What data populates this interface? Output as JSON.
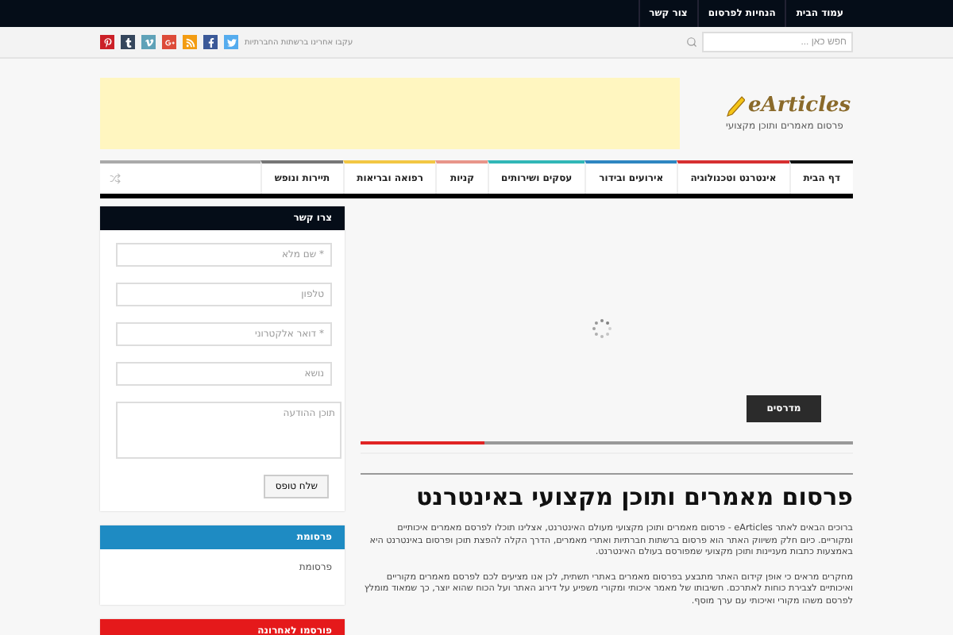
{
  "top_menu": [
    "עמוד הבית",
    "הנחיות לפרסום",
    "צור קשר"
  ],
  "search": {
    "placeholder": "חפש כאן ..."
  },
  "social_text": "עקבו אחרינו ברשתות החברתיות",
  "social": [
    {
      "kind": "twitter",
      "color": "#55acee"
    },
    {
      "kind": "facebook",
      "color": "#3b5998"
    },
    {
      "kind": "rss",
      "color": "#f39c12"
    },
    {
      "kind": "googleplus",
      "color": "#dd4b39"
    },
    {
      "kind": "vimeo",
      "color": "#5fa2b8"
    },
    {
      "kind": "tumblr",
      "color": "#35465c"
    },
    {
      "kind": "pinterest",
      "color": "#cb2027"
    }
  ],
  "logo": {
    "name": "eArticles",
    "tagline": "פרסום מאמרים ותוכן מקצועי"
  },
  "nav": [
    {
      "label": "דף הבית",
      "color": "#111111"
    },
    {
      "label": "אינטרנט וטכנולוגיה",
      "color": "#d63031"
    },
    {
      "label": "אירועים ובידור",
      "color": "#2e86c1"
    },
    {
      "label": "עסקים ושירותים",
      "color": "#31b7b7"
    },
    {
      "label": "קניות",
      "color": "#e8958a"
    },
    {
      "label": "רפואה ובריאות",
      "color": "#f2c744"
    },
    {
      "label": "תיירות ונופש",
      "color": "#777777"
    }
  ],
  "slider": {
    "button": "מדרסים",
    "level": 0.25
  },
  "title": "פרסום מאמרים ותוכן מקצועי באינטרנט",
  "paragraphs": [
    "ברוכים הבאים לאתר eArticles - פרסום מאמרים ותוכן מקצועי מעולם האינטרנט, אצלינו תוכלו לפרסם מאמרים איכותיים ומקוריים. כיום חלק משיווק האתר הוא פרסום ברשתות חברתיות ואתרי מאמרים, הדרך הקלה להפצת תוכן ופרסום באינטרנט היא באמצעות כתבות מעניינות ותוכן מקצועי שמפורסם בעולם האינטרנט.",
    "מחקרים מראים כי אופן קידום האתר מתבצע בפרסום מאמרים באתרי תשתית, לכן אנו מציעים לכם לפרסם מאמרים מקוריים ואיכותיים לצבירת כוחות לאתרכם. חשיבותו של מאמר איכותי ומקורי משפיע על דירוג האתר ועל הכוח שהוא יוצר, כך שמאוד מומלץ לפרסם משהו מקורי ואיכותי עם ערך מוסף."
  ],
  "contact": {
    "title": "צרו קשר",
    "fields": [
      {
        "placeholder": "* שם מלא"
      },
      {
        "placeholder": "טלפון"
      },
      {
        "placeholder": "* דואר אלקטרוני"
      },
      {
        "placeholder": "נושא"
      }
    ],
    "message": {
      "placeholder": "תוכן ההודעה"
    },
    "submit": "שלח טופס"
  },
  "widgets": [
    {
      "title": "פרסומת",
      "text": "פרסומת",
      "color": "#1e8bc3"
    },
    {
      "title": "פורסמו לאחרונה",
      "color": "#e5191b"
    }
  ]
}
